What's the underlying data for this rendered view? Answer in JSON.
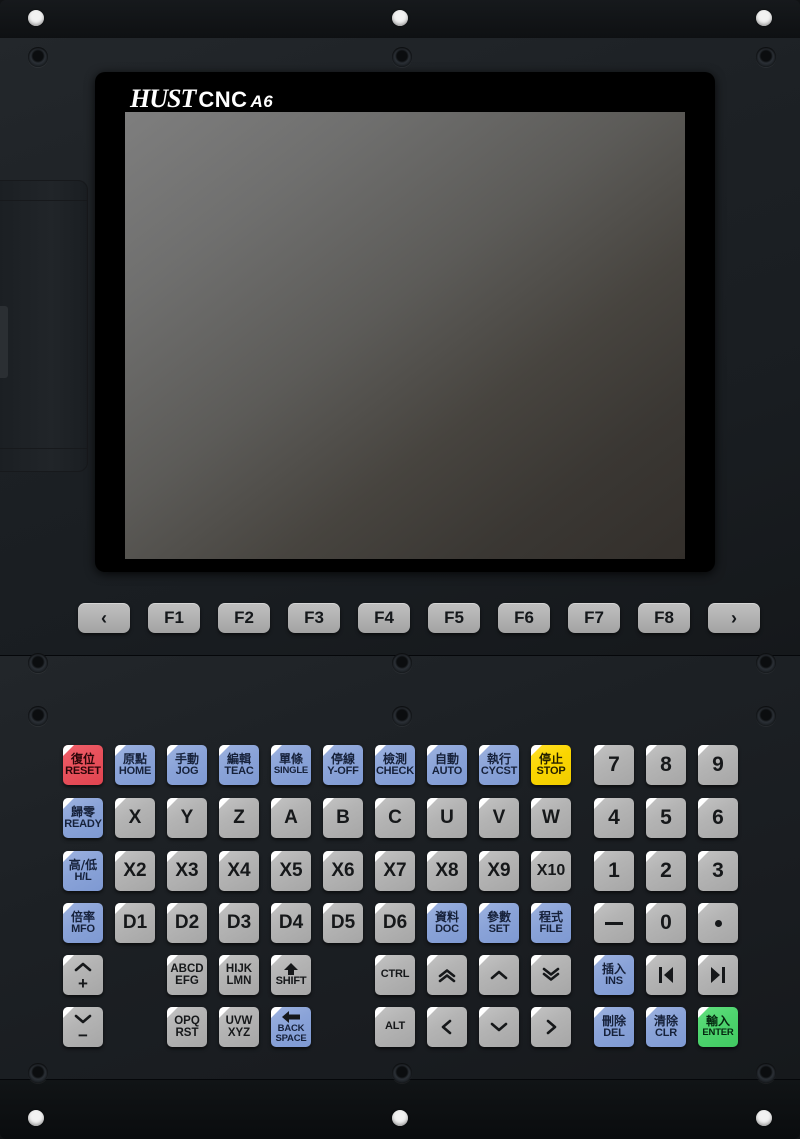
{
  "device": {
    "brand": "HUST",
    "product": "CNC",
    "model": "A6"
  },
  "function_keys": [
    {
      "name": "prev",
      "label": "‹",
      "type": "arrow"
    },
    {
      "name": "f1",
      "label": "F1",
      "type": "text"
    },
    {
      "name": "f2",
      "label": "F2",
      "type": "text"
    },
    {
      "name": "f3",
      "label": "F3",
      "type": "text"
    },
    {
      "name": "f4",
      "label": "F4",
      "type": "text"
    },
    {
      "name": "f5",
      "label": "F5",
      "type": "text"
    },
    {
      "name": "f6",
      "label": "F6",
      "type": "text"
    },
    {
      "name": "f7",
      "label": "F7",
      "type": "text"
    },
    {
      "name": "f8",
      "label": "F8",
      "type": "text"
    },
    {
      "name": "next",
      "label": "›",
      "type": "arrow"
    }
  ],
  "mode_keys": [
    {
      "name": "reset",
      "cn": "復位",
      "en": "RESET",
      "color": "red"
    },
    {
      "name": "home",
      "cn": "原點",
      "en": "HOME",
      "color": "blue"
    },
    {
      "name": "jog",
      "cn": "手動",
      "en": "JOG",
      "color": "blue"
    },
    {
      "name": "teac",
      "cn": "編輯",
      "en": "TEAC",
      "color": "blue"
    },
    {
      "name": "single",
      "cn": "單條",
      "en": "SINGLE",
      "color": "blue"
    },
    {
      "name": "y-off",
      "cn": "停線",
      "en": "Y-OFF",
      "color": "blue"
    },
    {
      "name": "check",
      "cn": "檢測",
      "en": "CHECK",
      "color": "blue"
    },
    {
      "name": "auto",
      "cn": "自動",
      "en": "AUTO",
      "color": "blue"
    },
    {
      "name": "cycst",
      "cn": "執行",
      "en": "CYCST",
      "color": "blue"
    },
    {
      "name": "stop",
      "cn": "停止",
      "en": "STOP",
      "color": "yellow"
    }
  ],
  "axis_row": {
    "lead": {
      "name": "ready",
      "cn": "歸零",
      "en": "READY",
      "color": "blue"
    },
    "keys": [
      "X",
      "Y",
      "Z",
      "A",
      "B",
      "C",
      "U",
      "V",
      "W"
    ]
  },
  "multiplier_row": {
    "lead": {
      "name": "high-low",
      "cn": "高/低",
      "en": "H/L",
      "color": "blue"
    },
    "keys": [
      "X2",
      "X3",
      "X4",
      "X5",
      "X6",
      "X7",
      "X8",
      "X9",
      "X10"
    ]
  },
  "device_row": {
    "lead": {
      "name": "mfo",
      "cn": "倍率",
      "en": "MFO",
      "color": "blue"
    },
    "keys": [
      "D1",
      "D2",
      "D3",
      "D4",
      "D5",
      "D6"
    ],
    "tail": [
      {
        "name": "doc",
        "cn": "資料",
        "en": "DOC",
        "color": "blue"
      },
      {
        "name": "set",
        "cn": "參數",
        "en": "SET",
        "color": "blue"
      },
      {
        "name": "file",
        "cn": "程式",
        "en": "FILE",
        "color": "blue"
      }
    ]
  },
  "numpad": {
    "rows": [
      [
        "7",
        "8",
        "9"
      ],
      [
        "4",
        "5",
        "6"
      ],
      [
        "1",
        "2",
        "3"
      ]
    ],
    "bottom": [
      {
        "name": "minus",
        "label": "−",
        "kind": "minus"
      },
      {
        "name": "zero",
        "label": "0",
        "kind": "digit"
      },
      {
        "name": "decimal-point",
        "label": ".",
        "kind": "dot"
      }
    ]
  },
  "jog_keys": [
    {
      "name": "jog-plus",
      "label": "+",
      "icon": "chevron-up-icon"
    },
    {
      "name": "jog-minus",
      "label": "−",
      "icon": "chevron-down-icon"
    }
  ],
  "letter_keys": [
    {
      "name": "abcd-efg",
      "line1": "ABCD",
      "line2": "EFG"
    },
    {
      "name": "hijk-lmn",
      "line1": "HIJK",
      "line2": "LMN"
    },
    {
      "name": "opq-rst",
      "line1": "OPQ",
      "line2": "RST"
    },
    {
      "name": "uvw-xyz",
      "line1": "UVW",
      "line2": "XYZ"
    }
  ],
  "edit_keys": {
    "shift": {
      "name": "shift",
      "en": "SHIFT",
      "color": "gray",
      "icon": "arrow-up-icon"
    },
    "backspace": {
      "name": "backspace",
      "line1": "BACK",
      "line2": "SPACE",
      "color": "blue",
      "icon": "arrow-left-icon"
    },
    "ctrl": {
      "name": "ctrl",
      "en": "CTRL",
      "color": "gray"
    },
    "alt": {
      "name": "alt",
      "en": "ALT",
      "color": "gray"
    }
  },
  "nav_keys": [
    {
      "name": "page-up",
      "icon": "double-chevron-up-icon"
    },
    {
      "name": "arrow-up",
      "icon": "chevron-up-icon"
    },
    {
      "name": "page-down",
      "icon": "double-chevron-down-icon"
    },
    {
      "name": "arrow-left",
      "icon": "chevron-left-icon"
    },
    {
      "name": "arrow-down",
      "icon": "chevron-down-icon"
    },
    {
      "name": "arrow-right",
      "icon": "chevron-right-icon"
    }
  ],
  "action_keys": {
    "ins": {
      "name": "insert",
      "cn": "插入",
      "en": "INS",
      "color": "blue"
    },
    "del": {
      "name": "delete",
      "cn": "刪除",
      "en": "DEL",
      "color": "blue"
    },
    "clr": {
      "name": "clear",
      "cn": "清除",
      "en": "CLR",
      "color": "blue"
    },
    "enter": {
      "name": "enter",
      "cn": "輸入",
      "en": "ENTER",
      "color": "green"
    },
    "home_key": {
      "name": "line-home",
      "icon": "skip-back-icon"
    },
    "end_key": {
      "name": "line-end",
      "icon": "skip-forward-icon"
    }
  },
  "colors": {
    "panel": "#1d2125",
    "key_gray": "#b4b4b4",
    "key_blue": "#8aa3d8",
    "key_red": "#e8515c",
    "key_yellow": "#fbd600",
    "key_green": "#4ed46e",
    "screen_light": "#7e7e7e",
    "screen_dark": "#332f2b"
  }
}
